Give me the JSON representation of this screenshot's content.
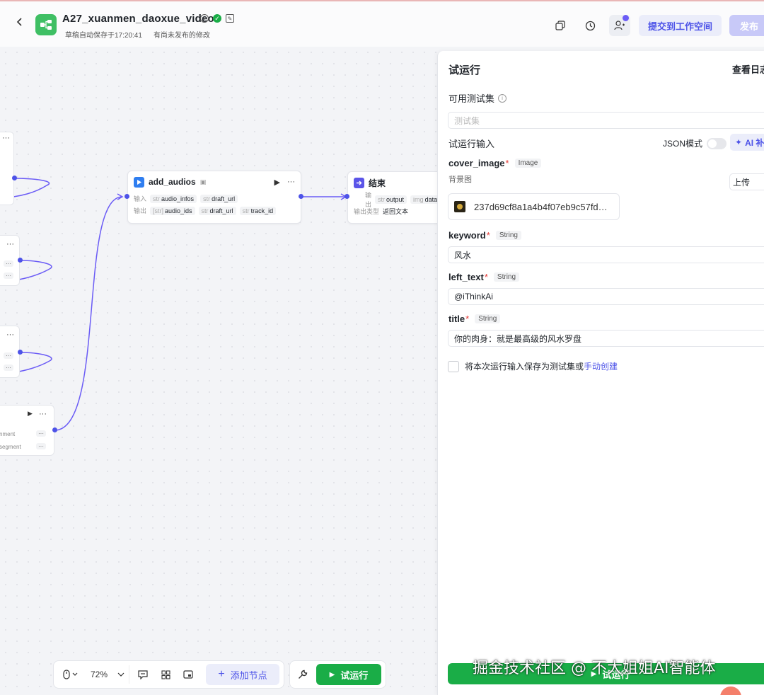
{
  "header": {
    "back_icon": "chevron-left-icon",
    "title": "A27_xuanmen_daoxue_video",
    "autosave": "草稿自动保存于17:20:41",
    "unpublished": "有尚未发布的修改",
    "submit_label": "提交到工作空间",
    "publish_label": "发布"
  },
  "canvas": {
    "add_audios": {
      "title": "add_audios",
      "input_label": "输入",
      "output_label": "输出",
      "inputs": [
        {
          "type": "str",
          "name": "audio_infos"
        },
        {
          "type": "str",
          "name": "draft_url"
        }
      ],
      "outputs": [
        {
          "type": "[str]",
          "name": "audio_ids"
        },
        {
          "type": "str",
          "name": "draft_url"
        },
        {
          "type": "str",
          "name": "track_id"
        }
      ]
    },
    "end_node": {
      "title": "结束",
      "output_label": "输出",
      "output_type_label": "输出类型",
      "outputs": [
        {
          "type": "str",
          "name": "output"
        },
        {
          "type": "img",
          "name": "data"
        }
      ],
      "output_type": "返回文本"
    },
    "partial_node_rows": [
      "nment",
      "segment"
    ]
  },
  "toolbar": {
    "zoom": "72%",
    "add_node_label": "添加节点",
    "run_label": "试运行"
  },
  "panel": {
    "title": "试运行",
    "view_log": "查看日志",
    "testset_label": "可用测试集",
    "testset_placeholder": "测试集",
    "run_input_label": "试运行输入",
    "json_mode": "JSON模式",
    "ai_label": "AI 补",
    "fields": {
      "cover_image": {
        "name": "cover_image",
        "type": "Image",
        "desc": "背景图",
        "upload": "上传",
        "file": "237d69cf8a1a4b4f07eb9c57fd…"
      },
      "keyword": {
        "name": "keyword",
        "type": "String",
        "value": "风水"
      },
      "left_text": {
        "name": "left_text",
        "type": "String",
        "value": "@iThinkAi"
      },
      "title": {
        "name": "title",
        "type": "String",
        "value": "你的肉身：就是最高级的风水罗盘"
      }
    },
    "save_text": "将本次运行输入保存为测试集或",
    "save_link": "手动创建",
    "run_button": "试运行"
  },
  "watermark": "掘金技术社区 @ 不大姐姐AI智能体",
  "colors": {
    "accent": "#4d53e8",
    "run_green": "#1aad47",
    "app_icon": "#3fbf64"
  }
}
